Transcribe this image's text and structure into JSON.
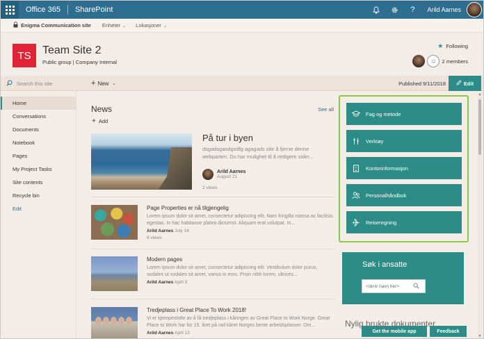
{
  "suite": {
    "brand": "Office 365",
    "app": "SharePoint",
    "user": "Arild Aarnes",
    "bell_icon": "bell-icon",
    "settings_icon": "gear-icon",
    "help_label": "?"
  },
  "hub": {
    "title": "Enigma Communication site",
    "nav": [
      "Enheter",
      "Lokasjoner"
    ]
  },
  "site": {
    "logo": "TS",
    "title": "Team Site 2",
    "meta": "Public group  |  Company Internal",
    "following": "Following",
    "members": "2 members"
  },
  "command": {
    "search_placeholder": "Search this site",
    "new": "New",
    "published": "Published 9/11/2018",
    "edit": "Edit"
  },
  "nav": [
    "Home",
    "Conversations",
    "Documents",
    "Notebook",
    "Pages",
    "My Project Tasks",
    "Site contents",
    "Recycle bin",
    "Edit"
  ],
  "news": {
    "title": "News",
    "see_all": "See all",
    "add": "Add",
    "hero": {
      "title": "På tur i byen",
      "desc": "dsgadsgasdgsdfg agagads site å fjerne denne webparten. Du har mulighet til å redigere sider...",
      "author": "Arild Aarnes",
      "date": "August 21",
      "views": "2 views"
    },
    "items": [
      {
        "title": "Page Properties er nå tilgjengelig",
        "desc": "Lorem ipsum dolor sit amet, consectetur adipiscing elit. Nam fringilla massa ac facilisis egestas. In hac habitasse platea dictumst. Aliquam erat volutpat. In...",
        "author": "Arild Aarnes",
        "date": "July 16",
        "views": "6 views"
      },
      {
        "title": "Modern pages",
        "desc": "Lorem ipsum dolor sit amet, consectetur adipiscing elit. Vestibulum dolor purus, sodales ut sodales sit amet, varius in eros. Proin nibh lorem, ultrices...",
        "author": "Arild Aarnes",
        "date": "April 3",
        "views": ""
      },
      {
        "title": "Tredjeplass i Great Place To Work 2018!",
        "desc": "Vi er kjempestolte av å få tredjeplass i kåringen av Great Place to Work Norge. Great Place to Work har for 15. året på rad kåret Norges beste arbeidsplasser. Om...",
        "author": "Arild Aarnes",
        "date": "April 13",
        "views": ""
      }
    ]
  },
  "quicklinks": [
    {
      "label": "Fag og metode",
      "icon": "graduation-cap-icon"
    },
    {
      "label": "Verktøy",
      "icon": "tools-icon"
    },
    {
      "label": "Kontorinformasjon",
      "icon": "building-icon"
    },
    {
      "label": "Personalhåndbok",
      "icon": "people-icon"
    },
    {
      "label": "Reiseregning",
      "icon": "airplane-icon"
    }
  ],
  "search_people": {
    "title": "Søk i ansatte",
    "placeholder": "<skriv navn her>"
  },
  "recent": "Nylig brukte dokumenter",
  "footer": {
    "mobile": "Get the mobile app",
    "feedback": "Feedback"
  }
}
